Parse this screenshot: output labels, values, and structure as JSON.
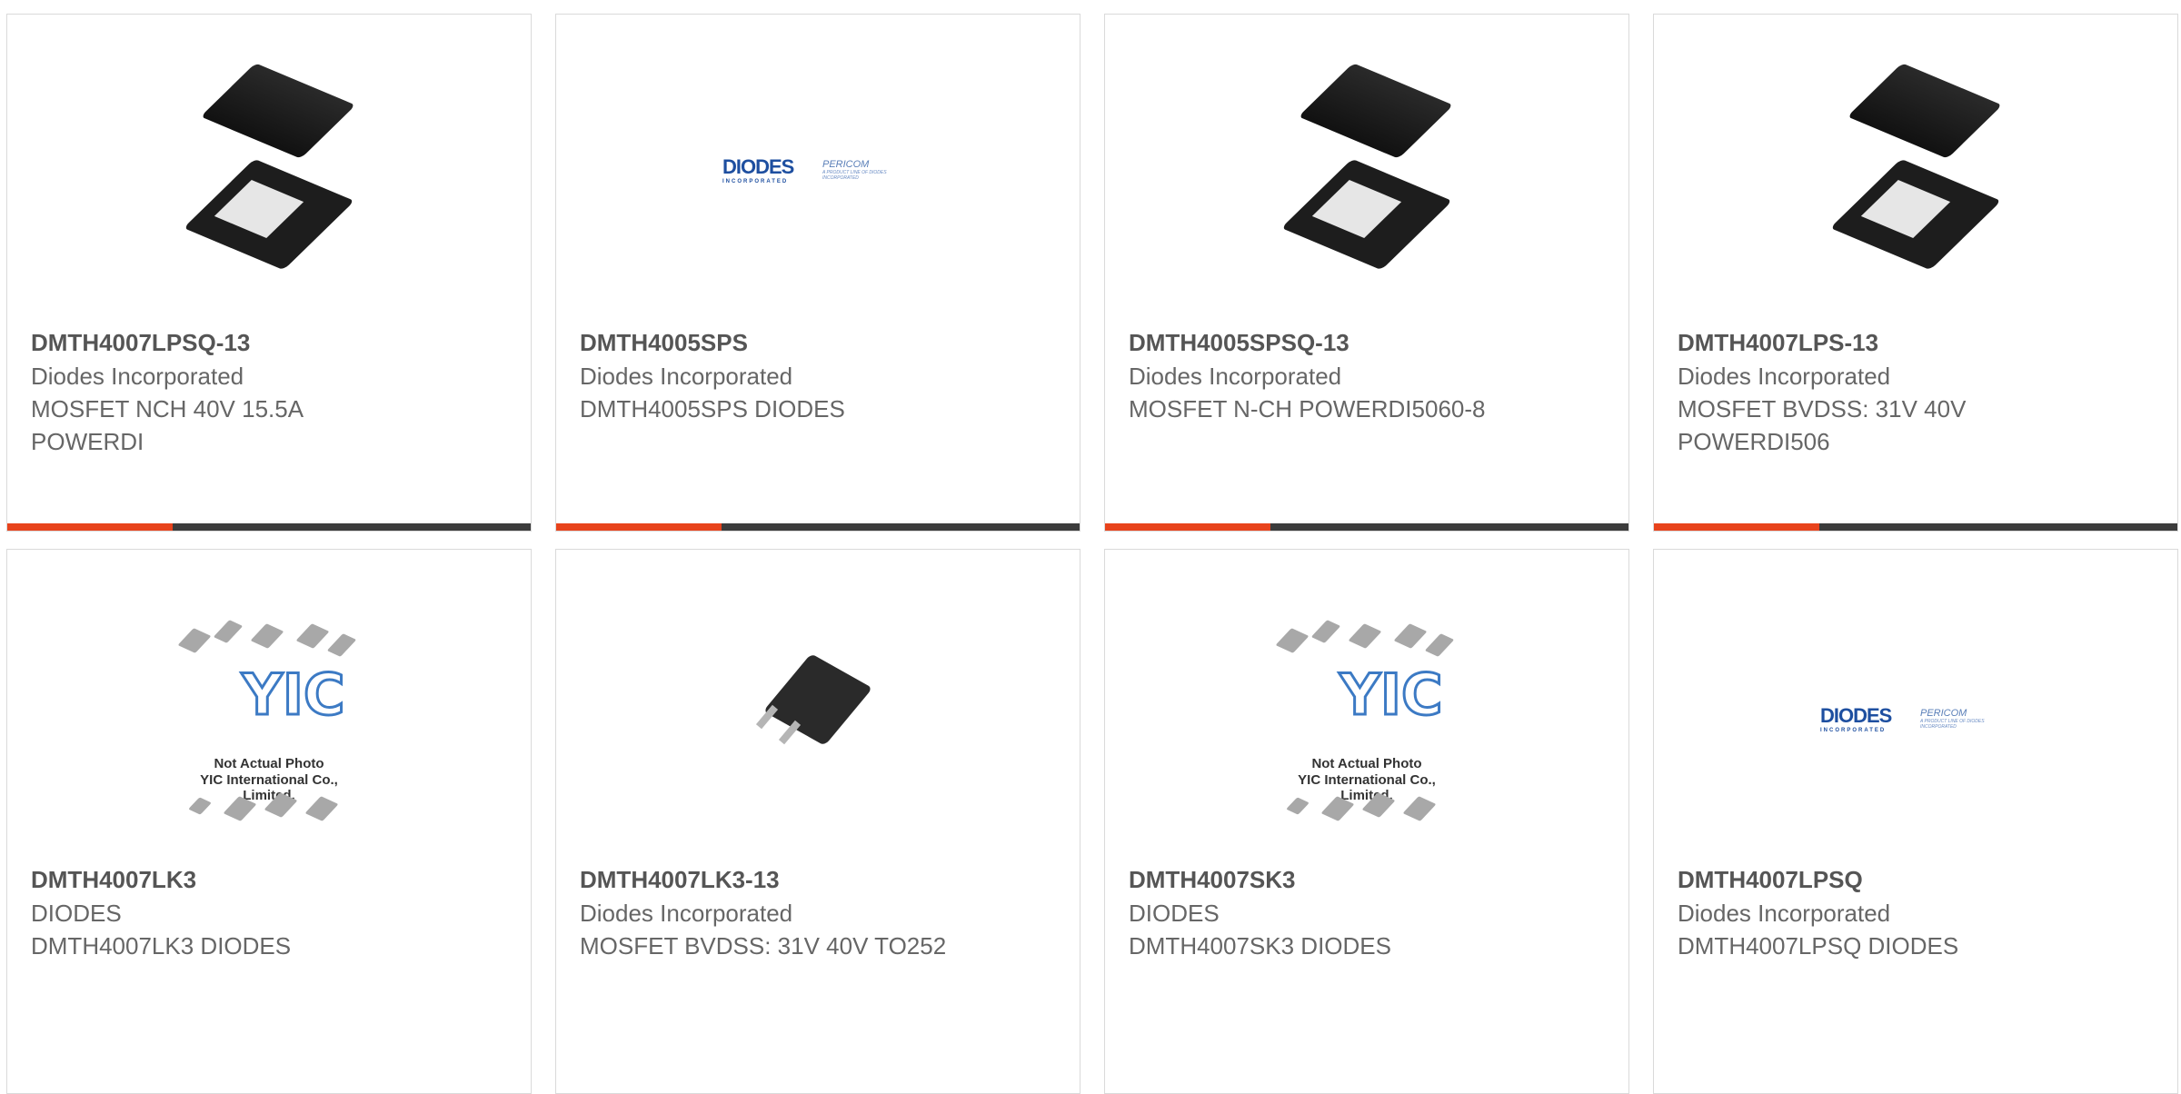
{
  "products": [
    {
      "part": "DMTH4007LPSQ-13",
      "manufacturer": "Diodes Incorporated",
      "description": "MOSFET NCH 40V 15.5A POWERDI",
      "image": "powerdi-package"
    },
    {
      "part": "DMTH4005SPS",
      "manufacturer": "Diodes Incorporated",
      "description": "DMTH4005SPS DIODES",
      "image": "diodes-pericom-logo"
    },
    {
      "part": "DMTH4005SPSQ-13",
      "manufacturer": "Diodes Incorporated",
      "description": "MOSFET N-CH POWERDI5060-8",
      "image": "powerdi-package"
    },
    {
      "part": "DMTH4007LPS-13",
      "manufacturer": "Diodes Incorporated",
      "description": "MOSFET BVDSS: 31V 40V POWERDI506",
      "image": "powerdi-package"
    },
    {
      "part": "DMTH4007LK3",
      "manufacturer": "DIODES",
      "description": "DMTH4007LK3 DIODES",
      "image": "yic-placeholder"
    },
    {
      "part": "DMTH4007LK3-13",
      "manufacturer": "Diodes Incorporated",
      "description": "MOSFET BVDSS: 31V 40V TO252",
      "image": "to252-package"
    },
    {
      "part": "DMTH4007SK3",
      "manufacturer": "DIODES",
      "description": "DMTH4007SK3 DIODES",
      "image": "yic-placeholder"
    },
    {
      "part": "DMTH4007LPSQ",
      "manufacturer": "Diodes Incorporated",
      "description": "DMTH4007LPSQ DIODES",
      "image": "diodes-pericom-logo"
    }
  ],
  "logo": {
    "diodes": "DIODES",
    "diodes_sub": "INCORPORATED",
    "pericom": "PERICOM",
    "pericom_sub": "A PRODUCT LINE OF DIODES INCORPORATED"
  },
  "yic": {
    "mark": "YIC",
    "line1": "Not Actual Photo",
    "line2": "YIC International Co., Limited."
  },
  "colors": {
    "accent": "#e8431c",
    "bar": "#3c3c3c",
    "border": "#dadada"
  }
}
